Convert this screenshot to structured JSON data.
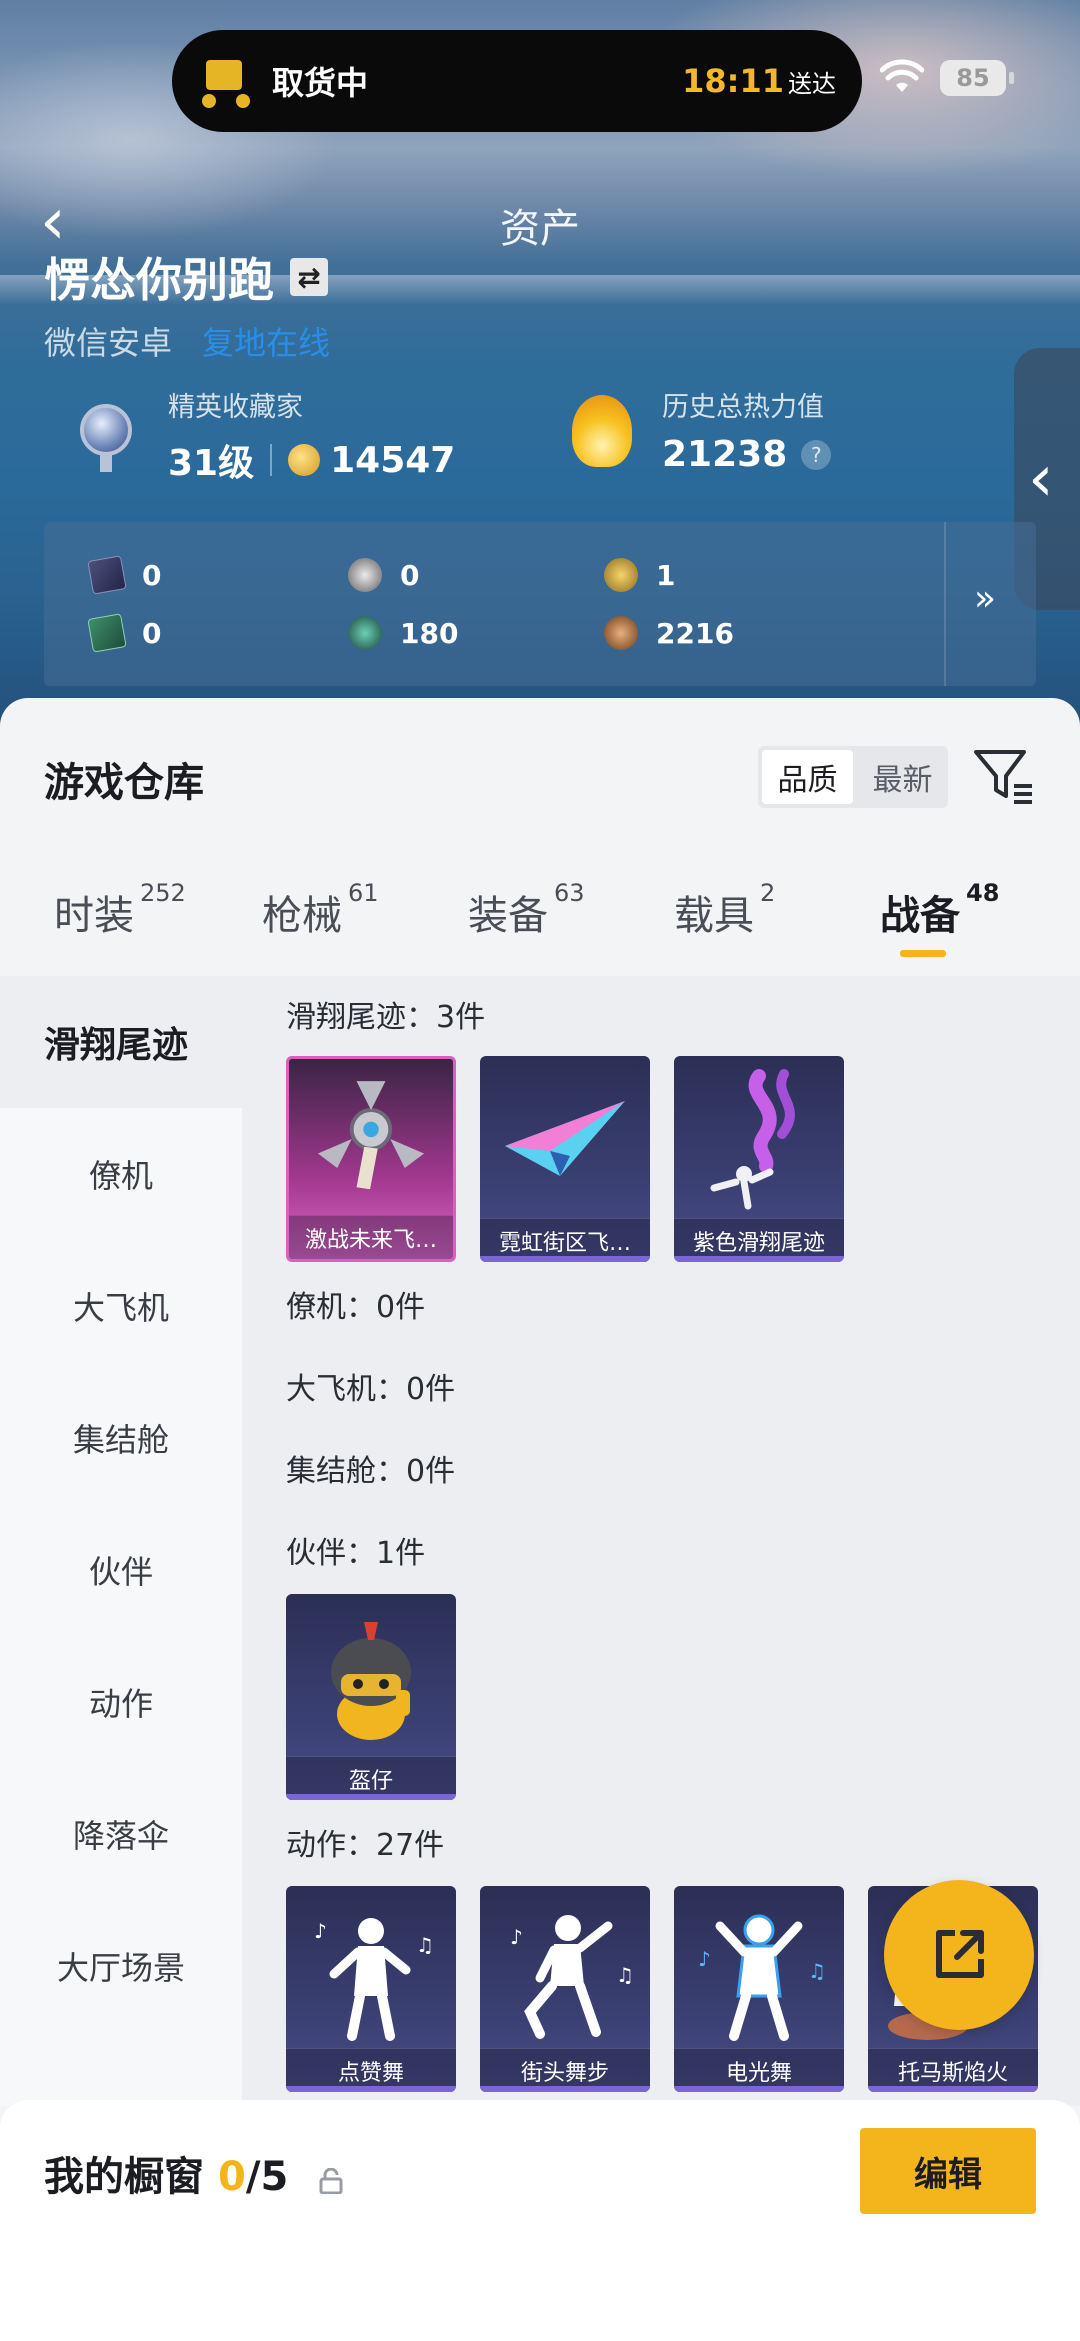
{
  "status_bar": {
    "delivery_title": "取货中",
    "delivery_time": "18:11",
    "delivery_suffix": "送达",
    "battery": "85"
  },
  "header": {
    "page_title": "资产",
    "username": "愣怂你别跑",
    "platform": "微信安卓",
    "server": "复地在线"
  },
  "stats": {
    "collector_label": "精英收藏家",
    "level": "31级",
    "points": "14547",
    "heat_label": "历史总热力值",
    "heat_value": "21238",
    "help": "?"
  },
  "currencies": [
    {
      "icon": "purple-card-icon",
      "value": "0"
    },
    {
      "icon": "silver-coin-icon",
      "value": "0"
    },
    {
      "icon": "gold-badge-coin-icon",
      "value": "1"
    },
    {
      "icon": "green-card-icon",
      "value": "0"
    },
    {
      "icon": "green-orb-icon",
      "value": "180"
    },
    {
      "icon": "bronze-coin-icon",
      "value": "2216"
    }
  ],
  "currency_more": "»",
  "warehouse": {
    "title": "游戏仓库",
    "sort_options": [
      "品质",
      "最新"
    ],
    "sort_active": "品质",
    "tabs": [
      {
        "label": "时装",
        "count": "252"
      },
      {
        "label": "枪械",
        "count": "61"
      },
      {
        "label": "装备",
        "count": "63"
      },
      {
        "label": "载具",
        "count": "2"
      },
      {
        "label": "战备",
        "count": "48"
      }
    ],
    "active_tab": "战备",
    "categories": [
      "滑翔尾迹",
      "僚机",
      "大飞机",
      "集结舱",
      "伙伴",
      "动作",
      "降落伞",
      "大厅场景"
    ],
    "active_category": "滑翔尾迹",
    "sections": [
      {
        "label": "滑翔尾迹：3件",
        "items": [
          "激战未来飞…",
          "霓虹街区飞…",
          "紫色滑翔尾迹"
        ]
      },
      {
        "label": "僚机：0件",
        "items": []
      },
      {
        "label": "大飞机：0件",
        "items": []
      },
      {
        "label": "集结舱：0件",
        "items": []
      },
      {
        "label": "伙伴：1件",
        "items": [
          "盔仔"
        ]
      },
      {
        "label": "动作：27件",
        "items": [
          "点赞舞",
          "街头舞步",
          "电光舞",
          "托马斯焰火"
        ]
      }
    ]
  },
  "showcase": {
    "title": "我的橱窗",
    "current": "0",
    "total": "/5",
    "edit_label": "编辑"
  },
  "colors": {
    "accent": "#f4b41c",
    "server_blue": "#2a8ee8",
    "legendary_pink": "#d95fc1",
    "epic_purple": "#3a3f72"
  }
}
